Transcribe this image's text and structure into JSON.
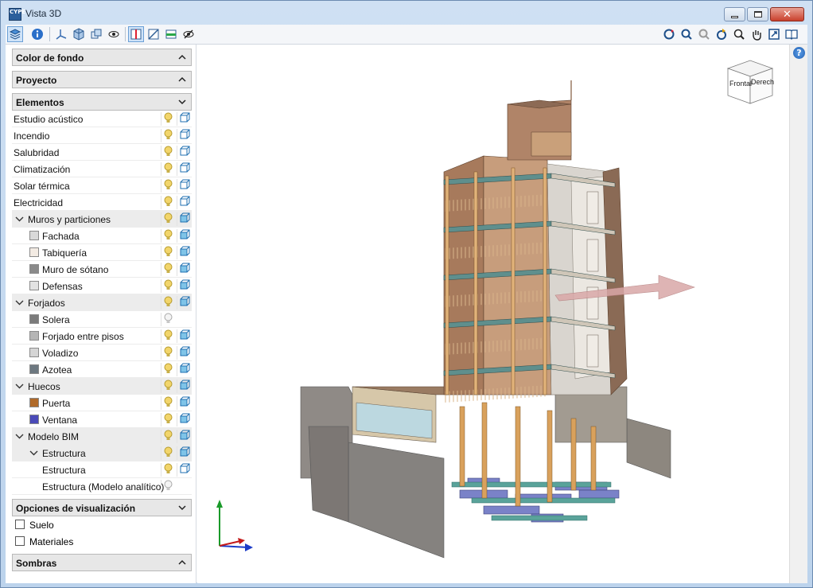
{
  "window": {
    "title": "Vista 3D",
    "app_icon_text": "CYPE"
  },
  "panel": {
    "sections": {
      "color_fondo": "Color de fondo",
      "proyecto": "Proyecto",
      "elementos": "Elementos",
      "opciones": "Opciones de visualización",
      "sombras": "Sombras"
    },
    "elements": [
      {
        "label": "Estudio acústico",
        "level": 0,
        "bulb": "on"
      },
      {
        "label": "Incendio",
        "level": 0,
        "bulb": "on"
      },
      {
        "label": "Salubridad",
        "level": 0,
        "bulb": "on"
      },
      {
        "label": "Climatización",
        "level": 0,
        "bulb": "on"
      },
      {
        "label": "Solar térmica",
        "level": 0,
        "bulb": "on"
      },
      {
        "label": "Electricidad",
        "level": 0,
        "bulb": "on"
      },
      {
        "label": "Muros y particiones",
        "level": 0,
        "group": true,
        "bulb": "on"
      },
      {
        "label": "Fachada",
        "level": 1,
        "swatch": "#d9d9d9",
        "bulb": "on"
      },
      {
        "label": "Tabiquería",
        "level": 1,
        "swatch": "#f3ebe3",
        "bulb": "on"
      },
      {
        "label": "Muro de sótano",
        "level": 1,
        "swatch": "#8a8a8a",
        "bulb": "on"
      },
      {
        "label": "Defensas",
        "level": 1,
        "swatch": "#e2e2e2",
        "bulb": "on"
      },
      {
        "label": "Forjados",
        "level": 0,
        "group": true,
        "bulb": "on"
      },
      {
        "label": "Solera",
        "level": 1,
        "swatch": "#7b7b7b",
        "bulb": "off"
      },
      {
        "label": "Forjado entre pisos",
        "level": 1,
        "swatch": "#b5b5b5",
        "bulb": "on"
      },
      {
        "label": "Voladizo",
        "level": 1,
        "swatch": "#d5d5d5",
        "bulb": "on"
      },
      {
        "label": "Azotea",
        "level": 1,
        "swatch": "#6d7880",
        "bulb": "on"
      },
      {
        "label": "Huecos",
        "level": 0,
        "group": true,
        "bulb": "on"
      },
      {
        "label": "Puerta",
        "level": 1,
        "swatch": "#b06a2a",
        "bulb": "on"
      },
      {
        "label": "Ventana",
        "level": 1,
        "swatch": "#4a4ab8",
        "bulb": "on"
      },
      {
        "label": "Modelo BIM",
        "level": 0,
        "group": true,
        "bulb": "on"
      },
      {
        "label": "Estructura",
        "level": 1,
        "group": true,
        "bulb": "on"
      },
      {
        "label": "Estructura",
        "level": 2,
        "bulb": "on"
      },
      {
        "label": "Estructura (Modelo analítico)",
        "level": 2,
        "bulb": "off"
      }
    ],
    "options": [
      {
        "label": "Suelo",
        "checked": false
      },
      {
        "label": "Materiales",
        "checked": false
      }
    ]
  },
  "navcube": {
    "front": "Frontal",
    "right": "Derecho"
  },
  "colors": {
    "accent": "#3a7bd5",
    "brick": "#a77a5c",
    "glass": "#7fb2c8",
    "beam": "#e2b37a",
    "foundation": "#7a82c8"
  }
}
